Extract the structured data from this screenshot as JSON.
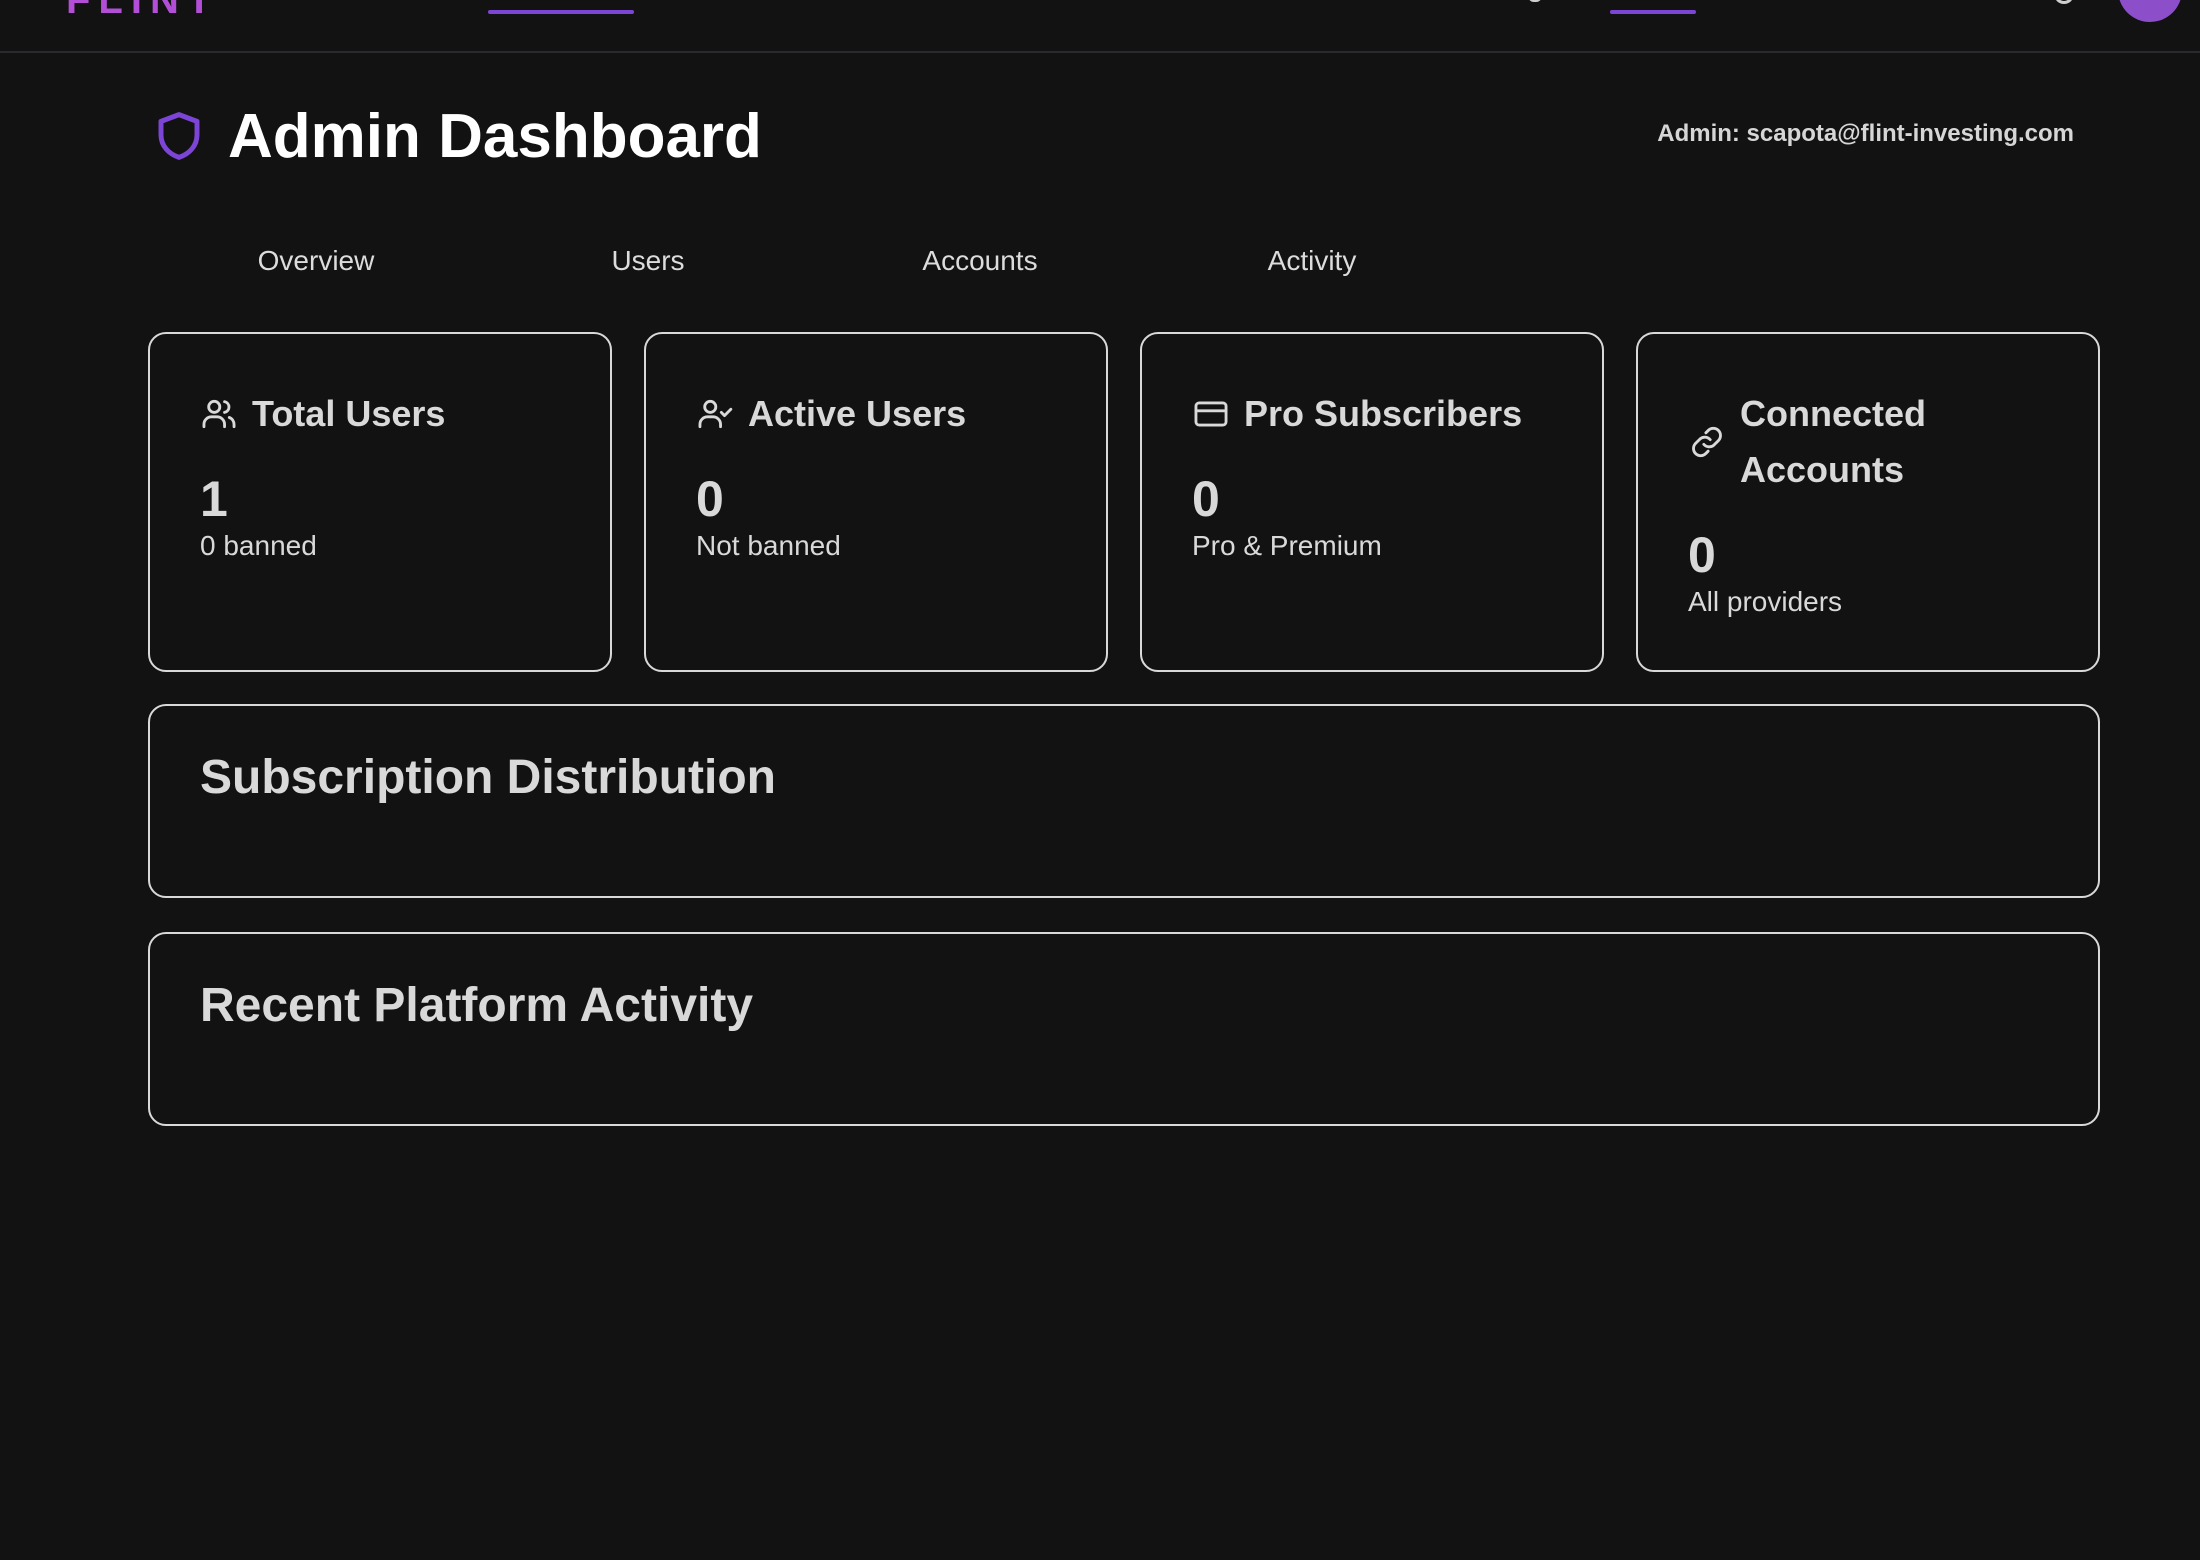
{
  "app": {
    "brand": "FLINT"
  },
  "header": {
    "title": "Admin Dashboard",
    "admin_label": "Admin: scapota@flint-investing.com",
    "accent_color": "#7d45d6"
  },
  "tabs": [
    {
      "label": "Overview"
    },
    {
      "label": "Users"
    },
    {
      "label": "Accounts"
    },
    {
      "label": "Activity"
    }
  ],
  "stats": [
    {
      "icon": "users-icon",
      "label": "Total Users",
      "value": "1",
      "sub": "0 banned"
    },
    {
      "icon": "user-check-icon",
      "label": "Active Users",
      "value": "0",
      "sub": "Not banned"
    },
    {
      "icon": "credit-card-icon",
      "label": "Pro Subscribers",
      "value": "0",
      "sub": "Pro & Premium"
    },
    {
      "icon": "link-icon",
      "label": "Connected Accounts",
      "value": "0",
      "sub": "All providers"
    }
  ],
  "sections": {
    "subscription": {
      "title": "Subscription Distribution"
    },
    "activity": {
      "title": "Recent Platform Activity"
    }
  }
}
